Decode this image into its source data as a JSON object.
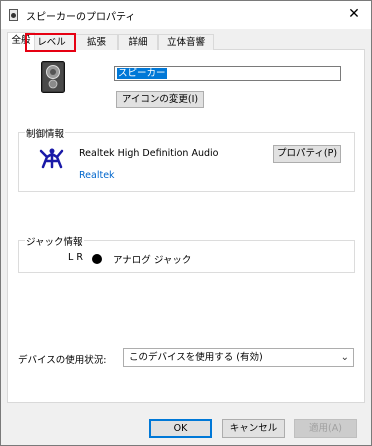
{
  "window": {
    "title": "スピーカーのプロパティ"
  },
  "tabs": [
    {
      "label": "全般",
      "active": true
    },
    {
      "label": "レベル",
      "active": false,
      "highlighted": true
    },
    {
      "label": "拡張",
      "active": false
    },
    {
      "label": "詳細",
      "active": false
    },
    {
      "label": "立体音響",
      "active": false
    }
  ],
  "device": {
    "name_value": "スピーカー",
    "change_icon_label": "アイコンの変更(I)"
  },
  "controller": {
    "group_label": "制御情報",
    "name": "Realtek High Definition Audio",
    "properties_label": "プロパティ(P)",
    "vendor": "Realtek"
  },
  "jack": {
    "group_label": "ジャック情報",
    "channels": "L R",
    "type": "アナログ ジャック"
  },
  "usage": {
    "label": "デバイスの使用状況:",
    "selected": "このデバイスを使用する (有効)"
  },
  "buttons": {
    "ok": "OK",
    "cancel": "キャンセル",
    "apply": "適用(A)"
  },
  "colors": {
    "highlight": "#e60012",
    "link": "#0066cc",
    "selection": "#0078d7"
  }
}
